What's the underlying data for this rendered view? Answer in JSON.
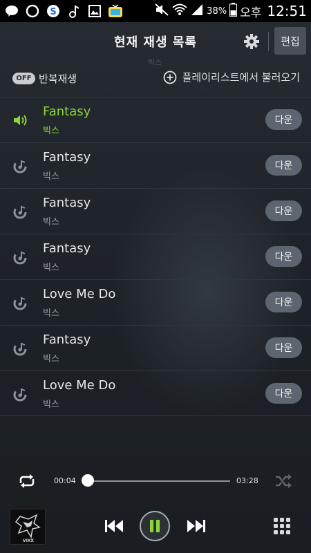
{
  "status_bar": {
    "battery_percent": "38%",
    "ampm": "오후",
    "time": "12:51",
    "icons": [
      "kakaotalk-icon",
      "line-icon",
      "s-icon",
      "music-note-icon",
      "image-icon",
      "tv-icon",
      "mute-icon",
      "wifi-icon",
      "signal-icon",
      "battery-icon"
    ]
  },
  "header": {
    "title": "현재 재생 목록",
    "edit_label": "편집",
    "settings_icon": "gear-icon"
  },
  "options": {
    "faint_text": "빅스",
    "repeat_toggle": "OFF",
    "repeat_label": "반복재생",
    "load_playlist_label": "플레이리스트에서 불러오기"
  },
  "playlist": [
    {
      "title": "Fantasy",
      "artist": "빅스",
      "button": "다운",
      "active": true
    },
    {
      "title": "Fantasy",
      "artist": "빅스",
      "button": "다운",
      "active": false
    },
    {
      "title": "Fantasy",
      "artist": "빅스",
      "button": "다운",
      "active": false
    },
    {
      "title": "Fantasy",
      "artist": "빅스",
      "button": "다운",
      "active": false
    },
    {
      "title": "Love Me Do",
      "artist": "빅스",
      "button": "다운",
      "active": false
    },
    {
      "title": "Fantasy",
      "artist": "빅스",
      "button": "다운",
      "active": false
    },
    {
      "title": "Love Me Do",
      "artist": "빅스",
      "button": "다운",
      "active": false
    }
  ],
  "player": {
    "current_time": "00:04",
    "total_time": "03:28",
    "progress_fraction": 0.02,
    "album_art_text": "VIXX"
  },
  "colors": {
    "accent_active": "#8dd63a",
    "background": "#1e2328"
  }
}
